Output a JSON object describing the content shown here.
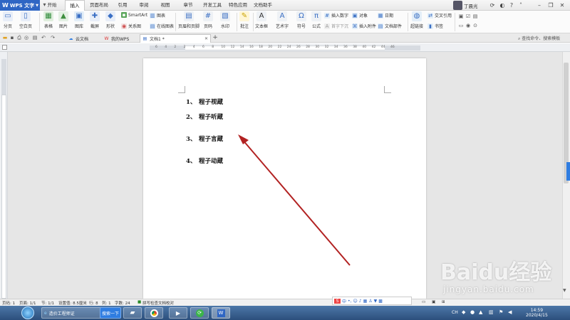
{
  "app": {
    "name": "WPS 文字",
    "user": "丁晨光"
  },
  "menu_tabs": [
    "开始",
    "插入",
    "页面布局",
    "引用",
    "审阅",
    "视图",
    "章节",
    "开发工具",
    "特色应用",
    "文档助手"
  ],
  "active_menu_tab": "插入",
  "ribbon": {
    "paging": "分页",
    "blank_page": "空白页",
    "table": "表格",
    "picture": "图片",
    "gallery": "图库",
    "screenshot": "截屏",
    "shapes": "形状",
    "smartart": "SmartArt",
    "chart": "图表",
    "relation_chart": "关系图",
    "online_chart": "在线图表",
    "header_footer": "页眉和页脚",
    "page_number": "页码",
    "watermark": "水印",
    "comment": "批注",
    "textbox": "文本框",
    "wordart": "艺术字",
    "symbol": "符号",
    "formula": "公式",
    "insert_number": "插入数字",
    "object": "对象",
    "date": "日期",
    "drop_cap": "首字下沉",
    "attachment": "插入附件",
    "doc_parts": "文档部件",
    "hyperlink": "超链接",
    "cross_ref": "交叉引用",
    "bookmark": "书签"
  },
  "doc_tabs": [
    {
      "label": "云文档"
    },
    {
      "label": "我的WPS"
    },
    {
      "label": "文档1 *"
    }
  ],
  "search_command": "查找命令、搜索模板",
  "ruler_numbers": [
    "6",
    "4",
    "2",
    "2",
    "4",
    "6",
    "8",
    "10",
    "12",
    "14",
    "16",
    "18",
    "20",
    "22",
    "24",
    "26",
    "28",
    "30",
    "32",
    "34",
    "36",
    "38",
    "40",
    "42",
    "44",
    "46"
  ],
  "document": {
    "items": [
      {
        "num": "1、",
        "text": "程子视蔵"
      },
      {
        "num": "2、",
        "text": "程子听蔵"
      },
      {
        "num": "3、",
        "text": "程子言蔵"
      },
      {
        "num": "4、",
        "text": "程子动蔵"
      }
    ]
  },
  "status": {
    "page_num": "页码: 1",
    "pages": "页面: 1/1",
    "section": "节: 1/1",
    "setting": "设置值: 8.5厘米",
    "row": "行: 8",
    "col": "列: 1",
    "chars": "字数: 24",
    "spellcheck": "拼写检查",
    "doc_check": "文档校对"
  },
  "taskbar": {
    "browser_tab": "造价工程师证",
    "search_btn": "搜索一下",
    "ime_lang": "CH",
    "time": "14:59",
    "date": "2020/4/15"
  },
  "watermark": {
    "main": "Baidu经验",
    "sub": "jingyan.baidu.com"
  },
  "colors": {
    "accent": "#2f66c4",
    "arrow": "#b22222"
  }
}
